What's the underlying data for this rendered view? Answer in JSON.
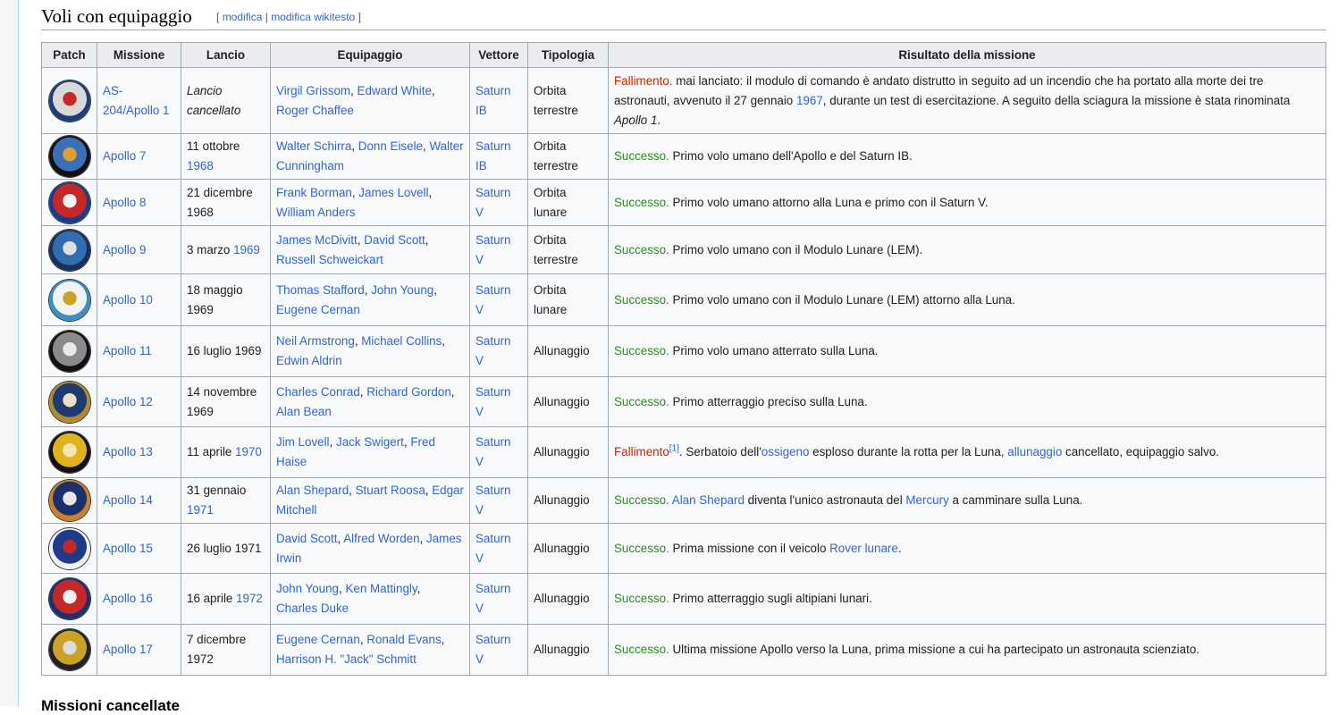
{
  "section": {
    "title": "Voli con equipaggio",
    "edit_open": "[",
    "edit_link": "modifica",
    "edit_sep": "|",
    "edit_wikitext": "modifica wikitesto",
    "edit_close": "]"
  },
  "table": {
    "headers": [
      "Patch",
      "Missione",
      "Lancio",
      "Equipaggio",
      "Vettore",
      "Tipologia",
      "Risultato della missione"
    ],
    "rows": [
      {
        "patch_colors": [
          "#1c3f7a",
          "#d9d9d9",
          "#c62828"
        ],
        "mission": "AS-204/Apollo 1",
        "launch": [
          {
            "t": "Lancio cancellato",
            "c": "ital"
          }
        ],
        "crew": [
          {
            "t": "Virgil Grissom",
            "c": "lnk"
          },
          {
            "t": ", ",
            "c": ""
          },
          {
            "t": "Edward White",
            "c": "lnk"
          },
          {
            "t": ", ",
            "c": ""
          },
          {
            "t": "Roger Chaffee",
            "c": "lnk"
          }
        ],
        "vector": "Saturn IB",
        "type": "Orbita terrestre",
        "result": [
          {
            "t": "Fallimento.",
            "c": "fail"
          },
          {
            "t": " mai lanciato: il modulo di comando è andato distrutto in seguito ad un incendio che ha portato alla morte dei tre astronauti, avvenuto il 27 gennaio ",
            "c": ""
          },
          {
            "t": "1967",
            "c": "lnk"
          },
          {
            "t": ", durante un test di esercitazione. A seguito della sciagura la missione è stata rinominata ",
            "c": ""
          },
          {
            "t": "Apollo 1",
            "c": "ital"
          },
          {
            "t": ".",
            "c": ""
          }
        ],
        "h": 74
      },
      {
        "patch_colors": [
          "#111111",
          "#3b6fb6",
          "#e0a030"
        ],
        "mission": "Apollo 7",
        "launch": [
          {
            "t": "11 ottobre ",
            "c": ""
          },
          {
            "t": "1968",
            "c": "lnk"
          }
        ],
        "crew": [
          {
            "t": "Walter Schirra",
            "c": "lnk"
          },
          {
            "t": ", ",
            "c": ""
          },
          {
            "t": "Donn Eisele",
            "c": "lnk"
          },
          {
            "t": ", ",
            "c": ""
          },
          {
            "t": "Walter Cunningham",
            "c": "lnk"
          }
        ],
        "vector": "Saturn IB",
        "type": "Orbita terrestre",
        "result": [
          {
            "t": "Successo.",
            "c": "succ"
          },
          {
            "t": " Primo volo umano dell'Apollo e del Saturn IB.",
            "c": ""
          }
        ],
        "h": 51
      },
      {
        "patch_colors": [
          "#1b3c8c",
          "#c62828",
          "#f2f2f2"
        ],
        "mission": "Apollo 8",
        "launch": [
          {
            "t": "21 dicembre 1968",
            "c": ""
          }
        ],
        "crew": [
          {
            "t": "Frank Borman",
            "c": "lnk"
          },
          {
            "t": ", ",
            "c": ""
          },
          {
            "t": "James Lovell",
            "c": "lnk"
          },
          {
            "t": ", ",
            "c": ""
          },
          {
            "t": "William Anders",
            "c": "lnk"
          }
        ],
        "vector": "Saturn V",
        "type": "Orbita lunare",
        "result": [
          {
            "t": "Successo.",
            "c": "succ"
          },
          {
            "t": " Primo volo umano attorno alla Luna e primo con il Saturn V.",
            "c": ""
          }
        ],
        "h": 52
      },
      {
        "patch_colors": [
          "#1a2f5a",
          "#2f6fb0",
          "#e0e0e0"
        ],
        "mission": "Apollo 9",
        "launch": [
          {
            "t": "3 marzo ",
            "c": ""
          },
          {
            "t": "1969",
            "c": "lnk"
          }
        ],
        "crew": [
          {
            "t": "James McDivitt",
            "c": "lnk"
          },
          {
            "t": ", ",
            "c": ""
          },
          {
            "t": "David Scott",
            "c": "lnk"
          },
          {
            "t": ", ",
            "c": ""
          },
          {
            "t": "Russell Schweickart",
            "c": "lnk"
          }
        ],
        "vector": "Saturn V",
        "type": "Orbita terrestre",
        "result": [
          {
            "t": "Successo.",
            "c": "succ"
          },
          {
            "t": " Primo volo umano con il Modulo Lunare (LEM).",
            "c": ""
          }
        ],
        "h": 54
      },
      {
        "patch_colors": [
          "#3a8fc7",
          "#f2f2f2",
          "#c9a227"
        ],
        "mission": "Apollo 10",
        "launch": [
          {
            "t": "18 maggio 1969",
            "c": ""
          }
        ],
        "crew": [
          {
            "t": "Thomas Stafford",
            "c": "lnk"
          },
          {
            "t": ", ",
            "c": ""
          },
          {
            "t": "John Young",
            "c": "lnk"
          },
          {
            "t": ", ",
            "c": ""
          },
          {
            "t": "Eugene Cernan",
            "c": "lnk"
          }
        ],
        "vector": "Saturn V",
        "type": "Orbita lunare",
        "result": [
          {
            "t": "Successo.",
            "c": "succ"
          },
          {
            "t": " Primo volo umano con il Modulo Lunare (LEM) attorno alla Luna.",
            "c": ""
          }
        ],
        "h": 58
      },
      {
        "patch_colors": [
          "#111111",
          "#8a8a8a",
          "#e8e8e8"
        ],
        "mission": "Apollo 11",
        "launch": [
          {
            "t": "16 luglio 1969",
            "c": ""
          }
        ],
        "crew": [
          {
            "t": "Neil Armstrong",
            "c": "lnk"
          },
          {
            "t": ", ",
            "c": ""
          },
          {
            "t": "Michael Collins",
            "c": "lnk"
          },
          {
            "t": ", ",
            "c": ""
          },
          {
            "t": "Edwin Aldrin",
            "c": "lnk"
          }
        ],
        "vector": "Saturn V",
        "type": "Allunaggio",
        "result": [
          {
            "t": "Successo.",
            "c": "succ"
          },
          {
            "t": " Primo volo umano atterrato sulla Luna.",
            "c": ""
          }
        ],
        "h": 57
      },
      {
        "patch_colors": [
          "#b08a2e",
          "#1e3a6e",
          "#e9e2c8"
        ],
        "mission": "Apollo 12",
        "launch": [
          {
            "t": "14 novembre 1969",
            "c": ""
          }
        ],
        "crew": [
          {
            "t": "Charles Conrad",
            "c": "lnk"
          },
          {
            "t": ", ",
            "c": ""
          },
          {
            "t": "Richard Gordon",
            "c": "lnk"
          },
          {
            "t": ", ",
            "c": ""
          },
          {
            "t": "Alan Bean",
            "c": "lnk"
          }
        ],
        "vector": "Saturn V",
        "type": "Allunaggio",
        "result": [
          {
            "t": "Successo.",
            "c": "succ"
          },
          {
            "t": " Primo atterraggio preciso sulla Luna.",
            "c": ""
          }
        ],
        "h": 56
      },
      {
        "patch_colors": [
          "#111111",
          "#e0b21e",
          "#f3e6b3"
        ],
        "mission": "Apollo 13",
        "launch": [
          {
            "t": "11 aprile ",
            "c": ""
          },
          {
            "t": "1970",
            "c": "lnk"
          }
        ],
        "crew": [
          {
            "t": "Jim Lovell",
            "c": "lnk"
          },
          {
            "t": ", ",
            "c": ""
          },
          {
            "t": "Jack Swigert",
            "c": "lnk"
          },
          {
            "t": ", ",
            "c": ""
          },
          {
            "t": "Fred Haise",
            "c": "lnk"
          }
        ],
        "vector": "Saturn V",
        "type": "Allunaggio",
        "result": [
          {
            "t": "Fallimento",
            "c": "fail"
          },
          {
            "t": "[1]",
            "c": "sup"
          },
          {
            "t": ". Serbatoio dell'",
            "c": ""
          },
          {
            "t": "ossigeno",
            "c": "lnk"
          },
          {
            "t": " esploso durante la rotta per la Luna, ",
            "c": ""
          },
          {
            "t": "allunaggio",
            "c": "lnk"
          },
          {
            "t": " cancellato, equipaggio salvo.",
            "c": ""
          }
        ],
        "h": 57
      },
      {
        "patch_colors": [
          "#c9822a",
          "#1b2f6a",
          "#e6e6e6"
        ],
        "mission": "Apollo 14",
        "launch": [
          {
            "t": "31 gennaio ",
            "c": ""
          },
          {
            "t": "1971",
            "c": "lnk"
          }
        ],
        "crew": [
          {
            "t": "Alan Shepard",
            "c": "lnk"
          },
          {
            "t": ", ",
            "c": ""
          },
          {
            "t": "Stuart Roosa",
            "c": "lnk"
          },
          {
            "t": ", ",
            "c": ""
          },
          {
            "t": "Edgar Mitchell",
            "c": "lnk"
          }
        ],
        "vector": "Saturn V",
        "type": "Allunaggio",
        "result": [
          {
            "t": "Successo.",
            "c": "succ"
          },
          {
            "t": " ",
            "c": ""
          },
          {
            "t": "Alan Shepard",
            "c": "lnk"
          },
          {
            "t": " diventa l'unico astronauta del ",
            "c": ""
          },
          {
            "t": "Mercury",
            "c": "lnk"
          },
          {
            "t": " a camminare sulla Luna.",
            "c": ""
          }
        ],
        "h": 51
      },
      {
        "patch_colors": [
          "#f2f2f2",
          "#1e3a8a",
          "#c62828"
        ],
        "mission": "Apollo 15",
        "launch": [
          {
            "t": "26 luglio 1971",
            "c": ""
          }
        ],
        "crew": [
          {
            "t": "David Scott",
            "c": "lnk"
          },
          {
            "t": ", ",
            "c": ""
          },
          {
            "t": "Alfred Worden",
            "c": "lnk"
          },
          {
            "t": ", ",
            "c": ""
          },
          {
            "t": "James Irwin",
            "c": "lnk"
          }
        ],
        "vector": "Saturn V",
        "type": "Allunaggio",
        "result": [
          {
            "t": "Successo.",
            "c": "succ"
          },
          {
            "t": " Prima missione con il veicolo ",
            "c": ""
          },
          {
            "t": "Rover lunare",
            "c": "lnk"
          },
          {
            "t": ".",
            "c": ""
          }
        ],
        "h": 56
      },
      {
        "patch_colors": [
          "#1e2f6e",
          "#c62828",
          "#f2f2f2"
        ],
        "mission": "Apollo 16",
        "launch": [
          {
            "t": "16 aprile ",
            "c": ""
          },
          {
            "t": "1972",
            "c": "lnk"
          }
        ],
        "crew": [
          {
            "t": "John Young",
            "c": "lnk"
          },
          {
            "t": ", ",
            "c": ""
          },
          {
            "t": "Ken Mattingly",
            "c": "lnk"
          },
          {
            "t": ", ",
            "c": ""
          },
          {
            "t": "Charles Duke",
            "c": "lnk"
          }
        ],
        "vector": "Saturn V",
        "type": "Allunaggio",
        "result": [
          {
            "t": "Successo.",
            "c": "succ"
          },
          {
            "t": " Primo atterraggio sugli altipiani lunari.",
            "c": ""
          }
        ],
        "h": 57
      },
      {
        "patch_colors": [
          "#222222",
          "#c9a227",
          "#dcdcdc"
        ],
        "mission": "Apollo 17",
        "launch": [
          {
            "t": "7 dicembre 1972",
            "c": ""
          }
        ],
        "crew": [
          {
            "t": "Eugene Cernan",
            "c": "lnk"
          },
          {
            "t": ", ",
            "c": ""
          },
          {
            "t": "Ronald Evans",
            "c": "lnk"
          },
          {
            "t": ", ",
            "c": ""
          },
          {
            "t": "Harrison H. \"Jack\" Schmitt",
            "c": "lnk"
          }
        ],
        "vector": "Saturn V",
        "type": "Allunaggio",
        "result": [
          {
            "t": "Successo.",
            "c": "succ"
          },
          {
            "t": " Ultima missione Apollo verso la Luna, prima missione a cui ha partecipato un astronauta scienziato.",
            "c": ""
          }
        ],
        "h": 57
      }
    ]
  },
  "next_section": {
    "title": "Missioni cancellate"
  }
}
